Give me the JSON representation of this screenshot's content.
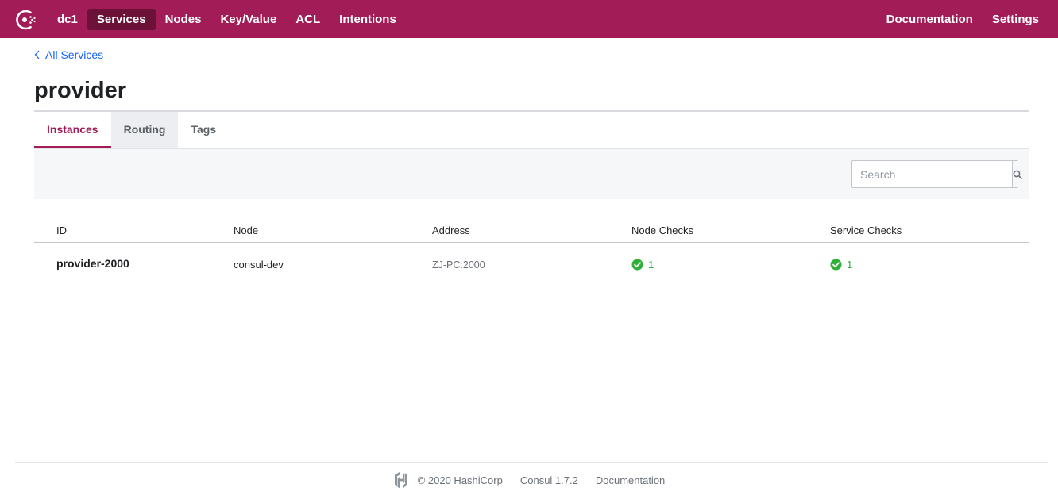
{
  "nav": {
    "logo_icon": "consul-logo-icon",
    "datacenter": "dc1",
    "items": [
      "Services",
      "Nodes",
      "Key/Value",
      "ACL",
      "Intentions"
    ],
    "active": "Services",
    "right_items": [
      "Documentation",
      "Settings"
    ]
  },
  "breadcrumb": {
    "label": "All Services",
    "icon": "chevron-left-icon"
  },
  "page": {
    "title": "provider"
  },
  "tabs": {
    "items": [
      "Instances",
      "Routing",
      "Tags"
    ],
    "active": "Instances"
  },
  "search": {
    "placeholder": "Search",
    "value": "",
    "icon": "search-icon"
  },
  "table": {
    "headers": [
      "ID",
      "Node",
      "Address",
      "Node Checks",
      "Service Checks"
    ],
    "rows": [
      {
        "id": "provider-2000",
        "node": "consul-dev",
        "address": "ZJ-PC:2000",
        "node_checks": "1",
        "service_checks": "1"
      }
    ]
  },
  "footer": {
    "logo_icon": "hashicorp-logo-icon",
    "copyright": "© 2020 HashiCorp",
    "version": "Consul 1.7.2",
    "docs": "Documentation"
  },
  "colors": {
    "brand": "#a21d57",
    "nav_active": "#6c1238",
    "link": "#1563ff",
    "passing": "#2eb039"
  }
}
